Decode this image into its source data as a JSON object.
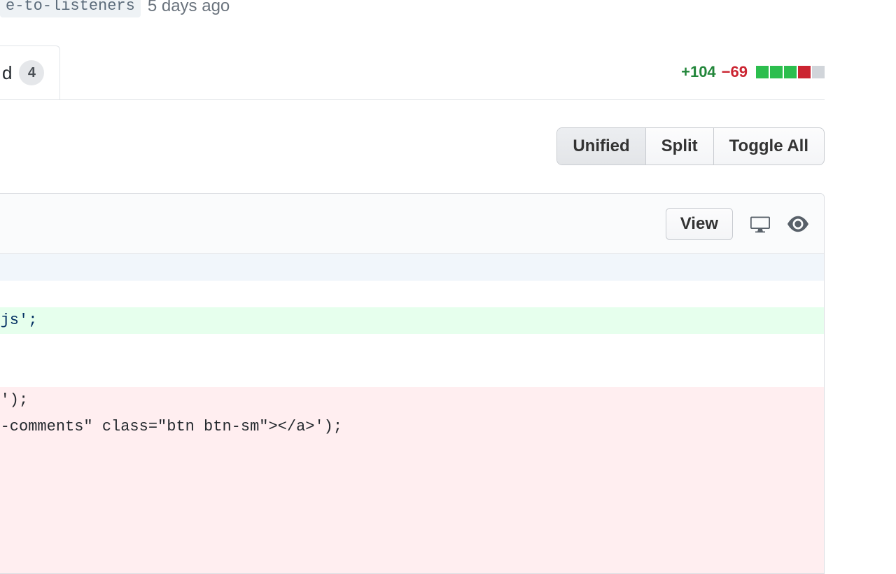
{
  "header": {
    "branch_fragment": "e-to-listeners",
    "timestamp": "5 days ago"
  },
  "tab": {
    "label_fragment": "d",
    "count": "4"
  },
  "diffstat": {
    "additions": "+104",
    "deletions": "−69",
    "blocks": [
      "green",
      "green",
      "green",
      "red",
      "grey"
    ]
  },
  "view_modes": {
    "unified": "Unified",
    "split": "Split",
    "toggle_all": "Toggle All"
  },
  "file": {
    "view_button": "View"
  },
  "code": {
    "l_add": "rs.js';",
    "l_rm1": "ght');",
    "l_rm2": "gle-comments\" class=\"btn btn-sm\"></a>');",
    "l_rm3": "');",
    "l_rm4": "{",
    "l_rm5": ";"
  }
}
